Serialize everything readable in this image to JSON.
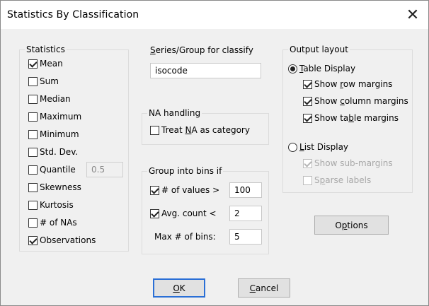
{
  "window": {
    "title": "Statistics By Classification",
    "close_glyph": "✕"
  },
  "statistics": {
    "label": "Statistics",
    "items": [
      {
        "label": "Mean",
        "checked": true
      },
      {
        "label": "Sum",
        "checked": false
      },
      {
        "label": "Median",
        "checked": false
      },
      {
        "label": "Maximum",
        "checked": false
      },
      {
        "label": "Minimum",
        "checked": false
      },
      {
        "label": "Std. Dev.",
        "checked": false
      },
      {
        "label": "Quantile",
        "checked": false
      },
      {
        "label": "Skewness",
        "checked": false
      },
      {
        "label": "Kurtosis",
        "checked": false
      },
      {
        "label": "# of NAs",
        "checked": false
      },
      {
        "label": "Observations",
        "checked": true
      }
    ],
    "quantile_value": "0.5"
  },
  "series": {
    "label_pre": "S",
    "label_post": "eries/Group for classify",
    "value": "isocode"
  },
  "na_handling": {
    "label": "NA handling",
    "treat_pre": "Treat ",
    "treat_u": "N",
    "treat_post": "A as category",
    "checked": false
  },
  "bins": {
    "label": "Group into bins if",
    "values_label": "# of values >",
    "values_checked": true,
    "values_value": "100",
    "avg_label": "Avg. count <",
    "avg_checked": true,
    "avg_value": "2",
    "max_label": "Max # of bins:",
    "max_value": "5"
  },
  "output": {
    "label": "Output layout",
    "table_display": {
      "u": "T",
      "rest": "able Display",
      "selected": true
    },
    "row_margins": {
      "pre": "Show ",
      "u": "r",
      "post": "ow margins",
      "checked": true
    },
    "column_margins": {
      "pre": "Show ",
      "u": "c",
      "post": "olumn margins",
      "checked": true
    },
    "table_margins": {
      "pre": "Show ta",
      "u": "b",
      "post": "le margins",
      "checked": true
    },
    "list_display": {
      "u": "L",
      "rest": "ist Display",
      "selected": false
    },
    "sub_margins": {
      "label": "Show sub-margins",
      "checked": true,
      "disabled": true
    },
    "sparse_labels": {
      "pre": "S",
      "u": "p",
      "post": "arse labels",
      "checked": false,
      "disabled": true
    }
  },
  "buttons": {
    "options": {
      "pre": "O",
      "u": "p",
      "post": "tions"
    },
    "ok": {
      "u": "O",
      "post": "K"
    },
    "cancel": {
      "u": "C",
      "post": "ancel"
    }
  }
}
